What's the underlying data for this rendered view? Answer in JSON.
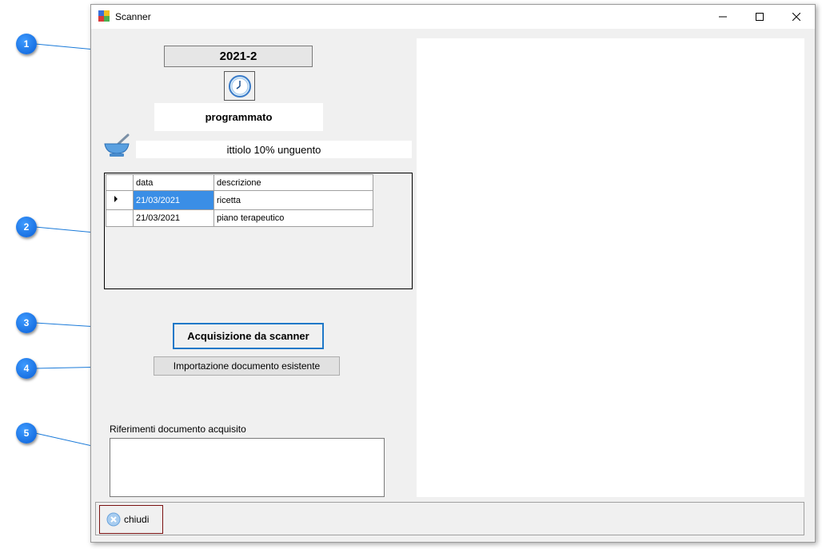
{
  "window": {
    "title": "Scanner"
  },
  "header": {
    "code": "2021-2",
    "status": "programmato",
    "product": "ittiolo 10% unguento"
  },
  "grid": {
    "columns": [
      "data",
      "descrizione"
    ],
    "rows": [
      {
        "data": "21/03/2021",
        "descrizione": "ricetta",
        "selected": true
      },
      {
        "data": "21/03/2021",
        "descrizione": "piano terapeutico",
        "selected": false
      }
    ]
  },
  "buttons": {
    "scan": "Acquisizione da scanner",
    "import": "Importazione documento esistente",
    "close": "chiudi"
  },
  "reference": {
    "label": "Riferimenti documento acquisito",
    "value": ""
  },
  "callouts": [
    "1",
    "2",
    "3",
    "4",
    "5"
  ],
  "colors": {
    "accent": "#1f78c8",
    "selection": "#3a8ee6",
    "callout": "#1877f2"
  }
}
